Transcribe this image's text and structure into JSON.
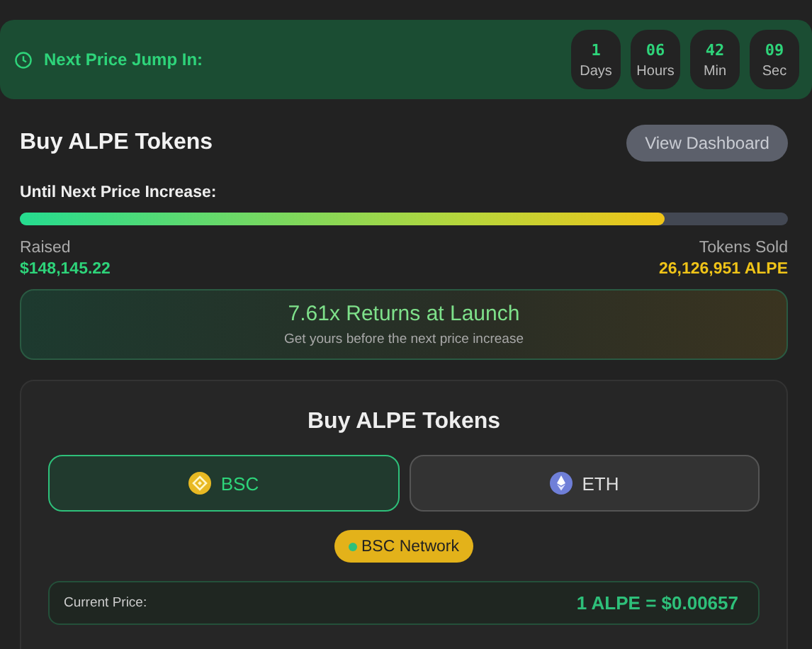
{
  "countdown": {
    "label": "Next Price Jump In:",
    "units": [
      {
        "value": "1",
        "unit": "Days"
      },
      {
        "value": "06",
        "unit": "Hours"
      },
      {
        "value": "42",
        "unit": "Min"
      },
      {
        "value": "09",
        "unit": "Sec"
      }
    ]
  },
  "header": {
    "title": "Buy ALPE Tokens",
    "button": "View Dashboard"
  },
  "progress": {
    "label": "Until Next Price Increase:",
    "level": 0.84
  },
  "stats": [
    {
      "label": "Raised",
      "value": "$148,145.22",
      "kind": "raised"
    },
    {
      "label": "Tokens Sold",
      "value": "26,126,951 ALPE",
      "kind": "sold"
    }
  ],
  "promo": {
    "title": "7.61x Returns at Launch",
    "subtitle": "Get yours before the next price increase"
  },
  "buy": {
    "title": "Buy ALPE Tokens",
    "networks": [
      {
        "label": "BSC",
        "kind": "bsc",
        "selected": true
      },
      {
        "label": "ETH",
        "kind": "eth",
        "selected": false
      }
    ],
    "badge": "BSC Network",
    "price": {
      "label": "Current Price:",
      "value": "1 ALPE = $0.00657"
    }
  }
}
